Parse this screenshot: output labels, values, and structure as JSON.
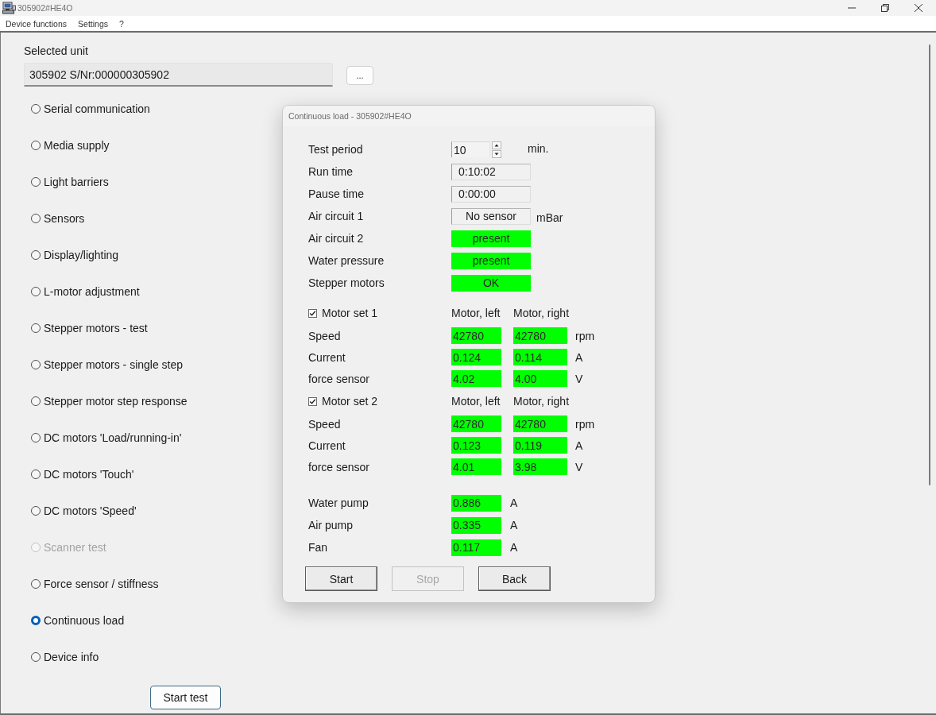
{
  "window": {
    "title": "305902#HE4O"
  },
  "menu": [
    "Device functions",
    "Settings",
    "?"
  ],
  "selected_unit": {
    "label": "Selected unit",
    "value": "305902 S/Nr:000000305902",
    "browse_button": "..."
  },
  "tests": [
    {
      "label": "Serial communication",
      "selected": false,
      "disabled": false
    },
    {
      "label": "Media supply",
      "selected": false,
      "disabled": false
    },
    {
      "label": "Light barriers",
      "selected": false,
      "disabled": false
    },
    {
      "label": "Sensors",
      "selected": false,
      "disabled": false
    },
    {
      "label": "Display/lighting",
      "selected": false,
      "disabled": false
    },
    {
      "label": "L-motor adjustment",
      "selected": false,
      "disabled": false
    },
    {
      "label": "Stepper motors - test",
      "selected": false,
      "disabled": false
    },
    {
      "label": "Stepper motors - single step",
      "selected": false,
      "disabled": false
    },
    {
      "label": "Stepper motor step response",
      "selected": false,
      "disabled": false
    },
    {
      "label": "DC motors 'Load/running-in'",
      "selected": false,
      "disabled": false
    },
    {
      "label": "DC motors 'Touch'",
      "selected": false,
      "disabled": false
    },
    {
      "label": "DC motors 'Speed'",
      "selected": false,
      "disabled": false
    },
    {
      "label": "Scanner test",
      "selected": false,
      "disabled": true
    },
    {
      "label": "Force sensor / stiffness",
      "selected": false,
      "disabled": false
    },
    {
      "label": "Continuous load",
      "selected": true,
      "disabled": false
    },
    {
      "label": "Device info",
      "selected": false,
      "disabled": false
    }
  ],
  "start_button": "Start test",
  "dialog": {
    "title": "Continuous load - 305902#HE4O",
    "rows": [
      {
        "kind": "spin",
        "label": "Test period",
        "value": "10",
        "unit": "min."
      },
      {
        "kind": "readout",
        "label": "Run time",
        "value": "0:10:02"
      },
      {
        "kind": "readout",
        "label": "Pause time",
        "value": "0:00:00"
      },
      {
        "kind": "status",
        "label": "Air circuit 1",
        "value": "No sensor",
        "ok": false,
        "unit": "mBar"
      },
      {
        "kind": "status",
        "label": "Air circuit 2",
        "value": "present",
        "ok": true
      },
      {
        "kind": "status",
        "label": "Water pressure",
        "value": "present",
        "ok": true
      },
      {
        "kind": "status",
        "label": "Stepper motors",
        "value": "OK",
        "ok": true
      }
    ],
    "motor_sets": [
      {
        "label": "Motor set 1",
        "checked": true,
        "columns": [
          "Motor, left",
          "Motor, right"
        ],
        "rows": [
          {
            "label": "Speed",
            "values": [
              {
                "text": "42780",
                "ok": true
              },
              {
                "text": "42780",
                "ok": true
              }
            ],
            "unit": "rpm"
          },
          {
            "label": "Current",
            "values": [
              {
                "text": "0.124",
                "ok": true
              },
              {
                "text": "0.114",
                "ok": true
              }
            ],
            "unit": "A"
          },
          {
            "label": "force sensor",
            "values": [
              {
                "text": "4.02",
                "ok": true
              },
              {
                "text": "4.00",
                "ok": true
              }
            ],
            "unit": "V"
          }
        ]
      },
      {
        "label": "Motor set 2",
        "checked": true,
        "columns": [
          "Motor, left",
          "Motor, right"
        ],
        "rows": [
          {
            "label": "Speed",
            "values": [
              {
                "text": "42780",
                "ok": true
              },
              {
                "text": "42780",
                "ok": true
              }
            ],
            "unit": "rpm"
          },
          {
            "label": "Current",
            "values": [
              {
                "text": "0.123",
                "ok": true
              },
              {
                "text": "0.119",
                "ok": true
              }
            ],
            "unit": "A"
          },
          {
            "label": "force sensor",
            "values": [
              {
                "text": "4.01",
                "ok": true
              },
              {
                "text": "3.98",
                "ok": true
              }
            ],
            "unit": "V"
          }
        ]
      }
    ],
    "pumps": [
      {
        "label": "Water pump",
        "value": "0.886",
        "ok": true,
        "unit": "A"
      },
      {
        "label": "Air pump",
        "value": "0.335",
        "ok": true,
        "unit": "A"
      },
      {
        "label": "Fan",
        "value": "0.117",
        "ok": true,
        "unit": "A"
      }
    ],
    "buttons": [
      {
        "label": "Start",
        "disabled": false
      },
      {
        "label": "Stop",
        "disabled": true
      },
      {
        "label": "Back",
        "disabled": false
      }
    ]
  }
}
